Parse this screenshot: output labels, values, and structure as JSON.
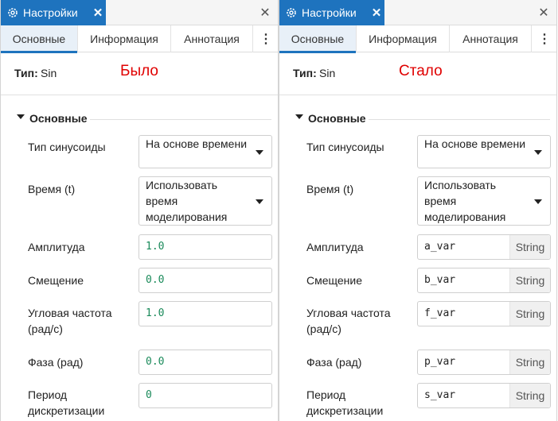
{
  "left": {
    "tab_title": "Настройки",
    "subtabs": [
      "Основные",
      "Информация",
      "Аннотация",
      "⋮"
    ],
    "type_label": "Тип:",
    "type_value": "Sin",
    "state_label": "Было",
    "section_title": "Основные",
    "fields": {
      "sine_type": {
        "label": "Тип синусоиды",
        "value": "На основе времени"
      },
      "time": {
        "label": "Время (t)",
        "value": "Использовать время моделирования"
      },
      "amplitude": {
        "label": "Амплитуда",
        "value": "1.0"
      },
      "offset": {
        "label": "Смещение",
        "value": "0.0"
      },
      "frequency": {
        "label": "Угловая частота (рад/с)",
        "value": "1.0"
      },
      "phase": {
        "label": "Фаза (рад)",
        "value": "0.0"
      },
      "sample_period": {
        "label": "Период дискретизации",
        "value": "0"
      }
    }
  },
  "right": {
    "tab_title": "Настройки",
    "subtabs": [
      "Основные",
      "Информация",
      "Аннотация",
      "⋮"
    ],
    "type_label": "Тип:",
    "type_value": "Sin",
    "state_label": "Стало",
    "section_title": "Основные",
    "type_tag": "String",
    "fields": {
      "sine_type": {
        "label": "Тип синусоиды",
        "value": "На основе времени"
      },
      "time": {
        "label": "Время (t)",
        "value": "Использовать время моделирования"
      },
      "amplitude": {
        "label": "Амплитуда",
        "value": "a_var"
      },
      "offset": {
        "label": "Смещение",
        "value": "b_var"
      },
      "frequency": {
        "label": "Угловая частота (рад/с)",
        "value": "f_var"
      },
      "phase": {
        "label": "Фаза (рад)",
        "value": "p_var"
      },
      "sample_period": {
        "label": "Период дискретизации",
        "value": "s_var"
      }
    }
  },
  "colors": {
    "accent": "#1e73be",
    "state_label": "#e00000",
    "numeric_value": "#1a8a5a"
  },
  "icons": {
    "tab": "gear-icon",
    "close": "close-icon",
    "menu": "more-vertical-icon",
    "dropdown": "chevron-down-icon",
    "section": "caret-down-icon"
  }
}
